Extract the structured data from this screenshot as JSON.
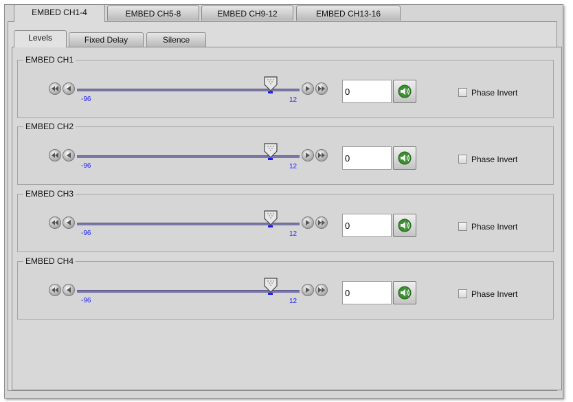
{
  "outer_tabs": [
    "EMBED CH1-4",
    "EMBED CH5-8",
    "EMBED CH9-12",
    "EMBED CH13-16"
  ],
  "inner_tabs": [
    "Levels",
    "Fixed Delay",
    "Silence"
  ],
  "channels": [
    {
      "title": "EMBED CH1",
      "min_label": "-96",
      "max_label": "12",
      "value": "0",
      "level_fraction": 0.87,
      "phase_label": "Phase Invert",
      "phase_checked": false
    },
    {
      "title": "EMBED CH2",
      "min_label": "-96",
      "max_label": "12",
      "value": "0",
      "level_fraction": 0.87,
      "phase_label": "Phase Invert",
      "phase_checked": false
    },
    {
      "title": "EMBED CH3",
      "min_label": "-96",
      "max_label": "12",
      "value": "0",
      "level_fraction": 0.87,
      "phase_label": "Phase Invert",
      "phase_checked": false
    },
    {
      "title": "EMBED CH4",
      "min_label": "-96",
      "max_label": "12",
      "value": "0",
      "level_fraction": 0.87,
      "phase_label": "Phase Invert",
      "phase_checked": false
    }
  ],
  "colors": {
    "track": "#7a78a8",
    "tick_labels": "#1a1aff",
    "speaker_green": "#2f8a2a"
  },
  "icons": {
    "left_double": "rewind-icon",
    "left_single": "step-left-icon",
    "right_single": "step-right-icon",
    "right_double": "fast-forward-icon",
    "speaker": "speaker-mute-icon"
  }
}
